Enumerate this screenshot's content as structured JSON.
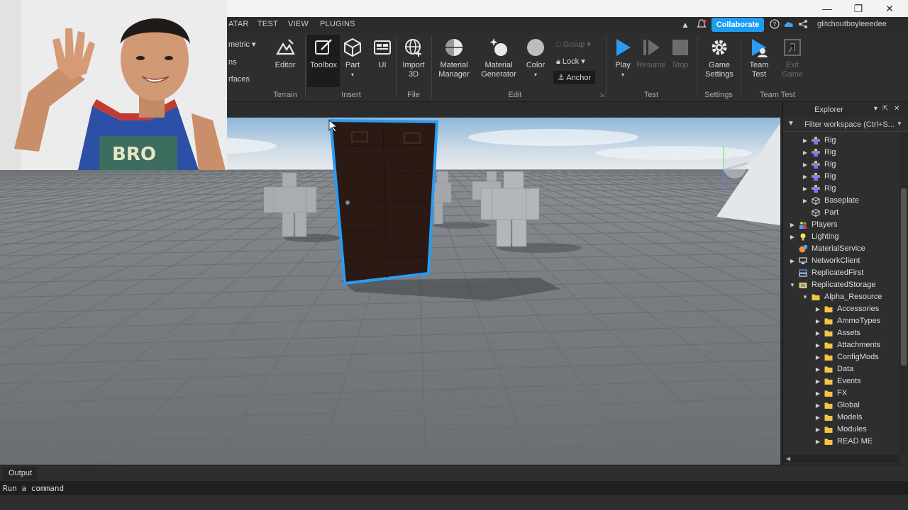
{
  "menubar": {
    "items": [
      "ATAR",
      "TEST",
      "VIEW",
      "PLUGINS"
    ],
    "collaborate_label": "Collaborate",
    "username": "glitchoutboyleeedee",
    "partial_mode": "metric",
    "partial_labels": [
      "ns",
      "rfaces"
    ]
  },
  "ribbon": {
    "tools": {
      "editor": "Editor",
      "toolbox": "Toolbox",
      "part": "Part",
      "ui": "UI",
      "import3d": [
        "Import",
        "3D"
      ],
      "material_manager": [
        "Material",
        "Manager"
      ],
      "material_generator": [
        "Material",
        "Generator"
      ],
      "color": "Color",
      "group": "Group",
      "lock": "Lock",
      "anchor": "Anchor",
      "play": "Play",
      "resume": "Resume",
      "stop": "Stop",
      "game_settings": [
        "Game",
        "Settings"
      ],
      "team_test": [
        "Team",
        "Test"
      ],
      "exit_game": [
        "Exit",
        "Game"
      ]
    },
    "groups": {
      "terrain": "Terrain",
      "insert": "Insert",
      "file": "File",
      "edit": "Edit",
      "test": "Test",
      "settings": "Settings",
      "team_test": "Team Test"
    }
  },
  "explorer": {
    "title": "Explorer",
    "filter_placeholder": "Filter workspace (Ctrl+S...",
    "items": [
      {
        "label": "Rig",
        "icon": "rig"
      },
      {
        "label": "Rig",
        "icon": "rig"
      },
      {
        "label": "Rig",
        "icon": "rig"
      },
      {
        "label": "Rig",
        "icon": "rig"
      },
      {
        "label": "Rig",
        "icon": "rig"
      },
      {
        "label": "Baseplate",
        "icon": "part"
      },
      {
        "label": "Part",
        "icon": "part"
      },
      {
        "label": "Players",
        "icon": "players"
      },
      {
        "label": "Lighting",
        "icon": "lighting"
      },
      {
        "label": "MaterialService",
        "icon": "material"
      },
      {
        "label": "NetworkClient",
        "icon": "network"
      },
      {
        "label": "ReplicatedFirst",
        "icon": "replicated"
      },
      {
        "label": "ReplicatedStorage",
        "icon": "storage"
      },
      {
        "label": "Alpha_Resource",
        "icon": "folder"
      },
      {
        "label": "Accessories",
        "icon": "folder"
      },
      {
        "label": "AmmoTypes",
        "icon": "folder"
      },
      {
        "label": "Assets",
        "icon": "folder"
      },
      {
        "label": "Attachments",
        "icon": "folder"
      },
      {
        "label": "ConfigMods",
        "icon": "folder"
      },
      {
        "label": "Data",
        "icon": "folder"
      },
      {
        "label": "Events",
        "icon": "folder"
      },
      {
        "label": "FX",
        "icon": "folder"
      },
      {
        "label": "Global",
        "icon": "folder"
      },
      {
        "label": "Models",
        "icon": "folder"
      },
      {
        "label": "Modules",
        "icon": "folder"
      },
      {
        "label": "READ ME",
        "icon": "folder"
      }
    ]
  },
  "output": {
    "tab_label": "Output",
    "command_placeholder": "Run a command"
  },
  "colors": {
    "accent": "#1e9cf0",
    "selection": "#2a9cf5",
    "folder": "#f3c544"
  }
}
